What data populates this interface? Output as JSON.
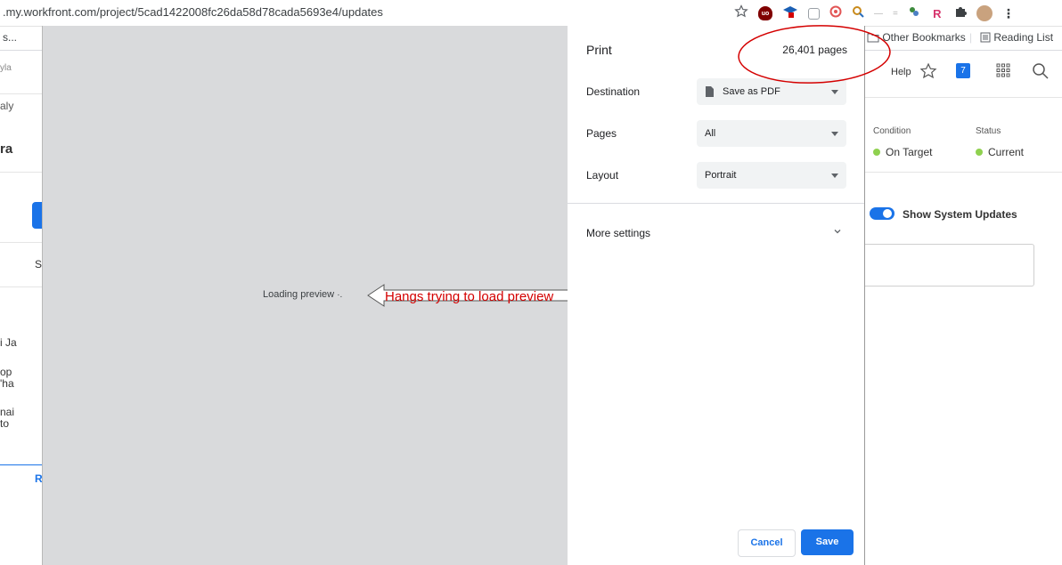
{
  "browser": {
    "url": ".my.workfront.com/project/5cad1422008fc26da58d78cada5693e4/updates",
    "bookmarks": {
      "left_item": "s...",
      "other_bookmarks": "Other Bookmarks",
      "reading_list": "Reading List"
    },
    "toolbar_icons": [
      "star-icon",
      "ublock-icon",
      "graduation-cap-icon",
      "square-icon",
      "target-icon",
      "magnifier-icon",
      "dash-icon",
      "equals-icon",
      "puzzle-leaf-icon",
      "r-extension-icon",
      "puzzle-icon",
      "profile-avatar",
      "menu-kebab-icon"
    ]
  },
  "background_page": {
    "left_fragments": [
      "yla",
      "aly",
      "ra",
      "S",
      "i Ja",
      "op",
      "'ha",
      "nai",
      "to",
      "R"
    ],
    "header": {
      "help": "Help",
      "notification_count": "7"
    },
    "condition_label": "Condition",
    "condition_value": "On Target",
    "status_label": "Status",
    "status_value": "Current",
    "toggle_label": "Show System Updates",
    "colors": {
      "toggle": "#1a73e8",
      "status_dot": "#8fd14f",
      "badge": "#1a73e8"
    }
  },
  "preview": {
    "loading_text": "Loading preview",
    "annotation": "Hangs trying to load preview",
    "annotation_color": "#d40000"
  },
  "print_dialog": {
    "title": "Print",
    "page_count": "26,401 pages",
    "destination_label": "Destination",
    "destination_value": "Save as PDF",
    "pages_label": "Pages",
    "pages_value": "All",
    "layout_label": "Layout",
    "layout_value": "Portrait",
    "more_settings": "More settings",
    "cancel": "Cancel",
    "save": "Save",
    "colors": {
      "primary": "#1a73e8",
      "select_bg": "#f1f3f4"
    }
  }
}
